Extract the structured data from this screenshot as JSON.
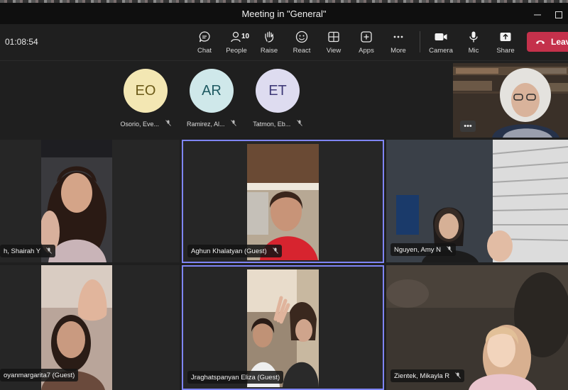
{
  "window": {
    "title": "Meeting in \"General\""
  },
  "toolbar": {
    "timer": "01:08:54",
    "chat": "Chat",
    "people": "People",
    "people_count": "10",
    "raise": "Raise",
    "react": "React",
    "view": "View",
    "apps": "Apps",
    "more": "More",
    "camera": "Camera",
    "mic": "Mic",
    "share": "Share",
    "leave": "Leave"
  },
  "avatars": [
    {
      "initials": "EO",
      "name": "Osorio, Eve...",
      "color": "#f3e7b3"
    },
    {
      "initials": "AR",
      "name": "Ramirez, Al...",
      "color": "#cfe8ea"
    },
    {
      "initials": "ET",
      "name": "Tatmon, Eb...",
      "color": "#dedcf0"
    }
  ],
  "participants": [
    {
      "name": "h, Shairah Y"
    },
    {
      "name": "Aghun Khalatyan (Guest)"
    },
    {
      "name": "Nguyen, Amy N"
    },
    {
      "name": "oyanmargarita7 (Guest)"
    },
    {
      "name": "Jraghatspanyan Eliza (Guest)"
    },
    {
      "name": "Zientek, Mikayla R"
    }
  ],
  "colors": {
    "accent": "#7f85f5",
    "leave": "#c4314b"
  }
}
